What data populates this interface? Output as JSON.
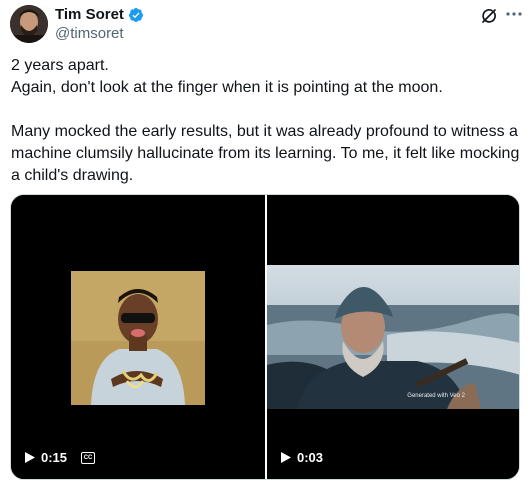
{
  "author": {
    "name": "Tim Soret",
    "handle": "@timsoret",
    "verified_color": "#1d9bf0"
  },
  "icons": {
    "verified": "verified-badge-icon",
    "grok": "grok-icon",
    "more": "more-options-icon",
    "play": "play-icon",
    "captions": "captions-icon"
  },
  "tweet": {
    "paragraph_1": "2 years apart.\nAgain, don't look at the finger when it is pointing at the moon.",
    "paragraph_2": "Many mocked the early results, but it was already profound to witness a machine clumsily hallucinate from its learning. To me, it felt like mocking a child's drawing."
  },
  "media": {
    "video_left": {
      "duration": "0:15",
      "captions_label": "CC"
    },
    "video_right": {
      "duration": "0:03",
      "watermark": "Generated with Veo 2"
    }
  }
}
